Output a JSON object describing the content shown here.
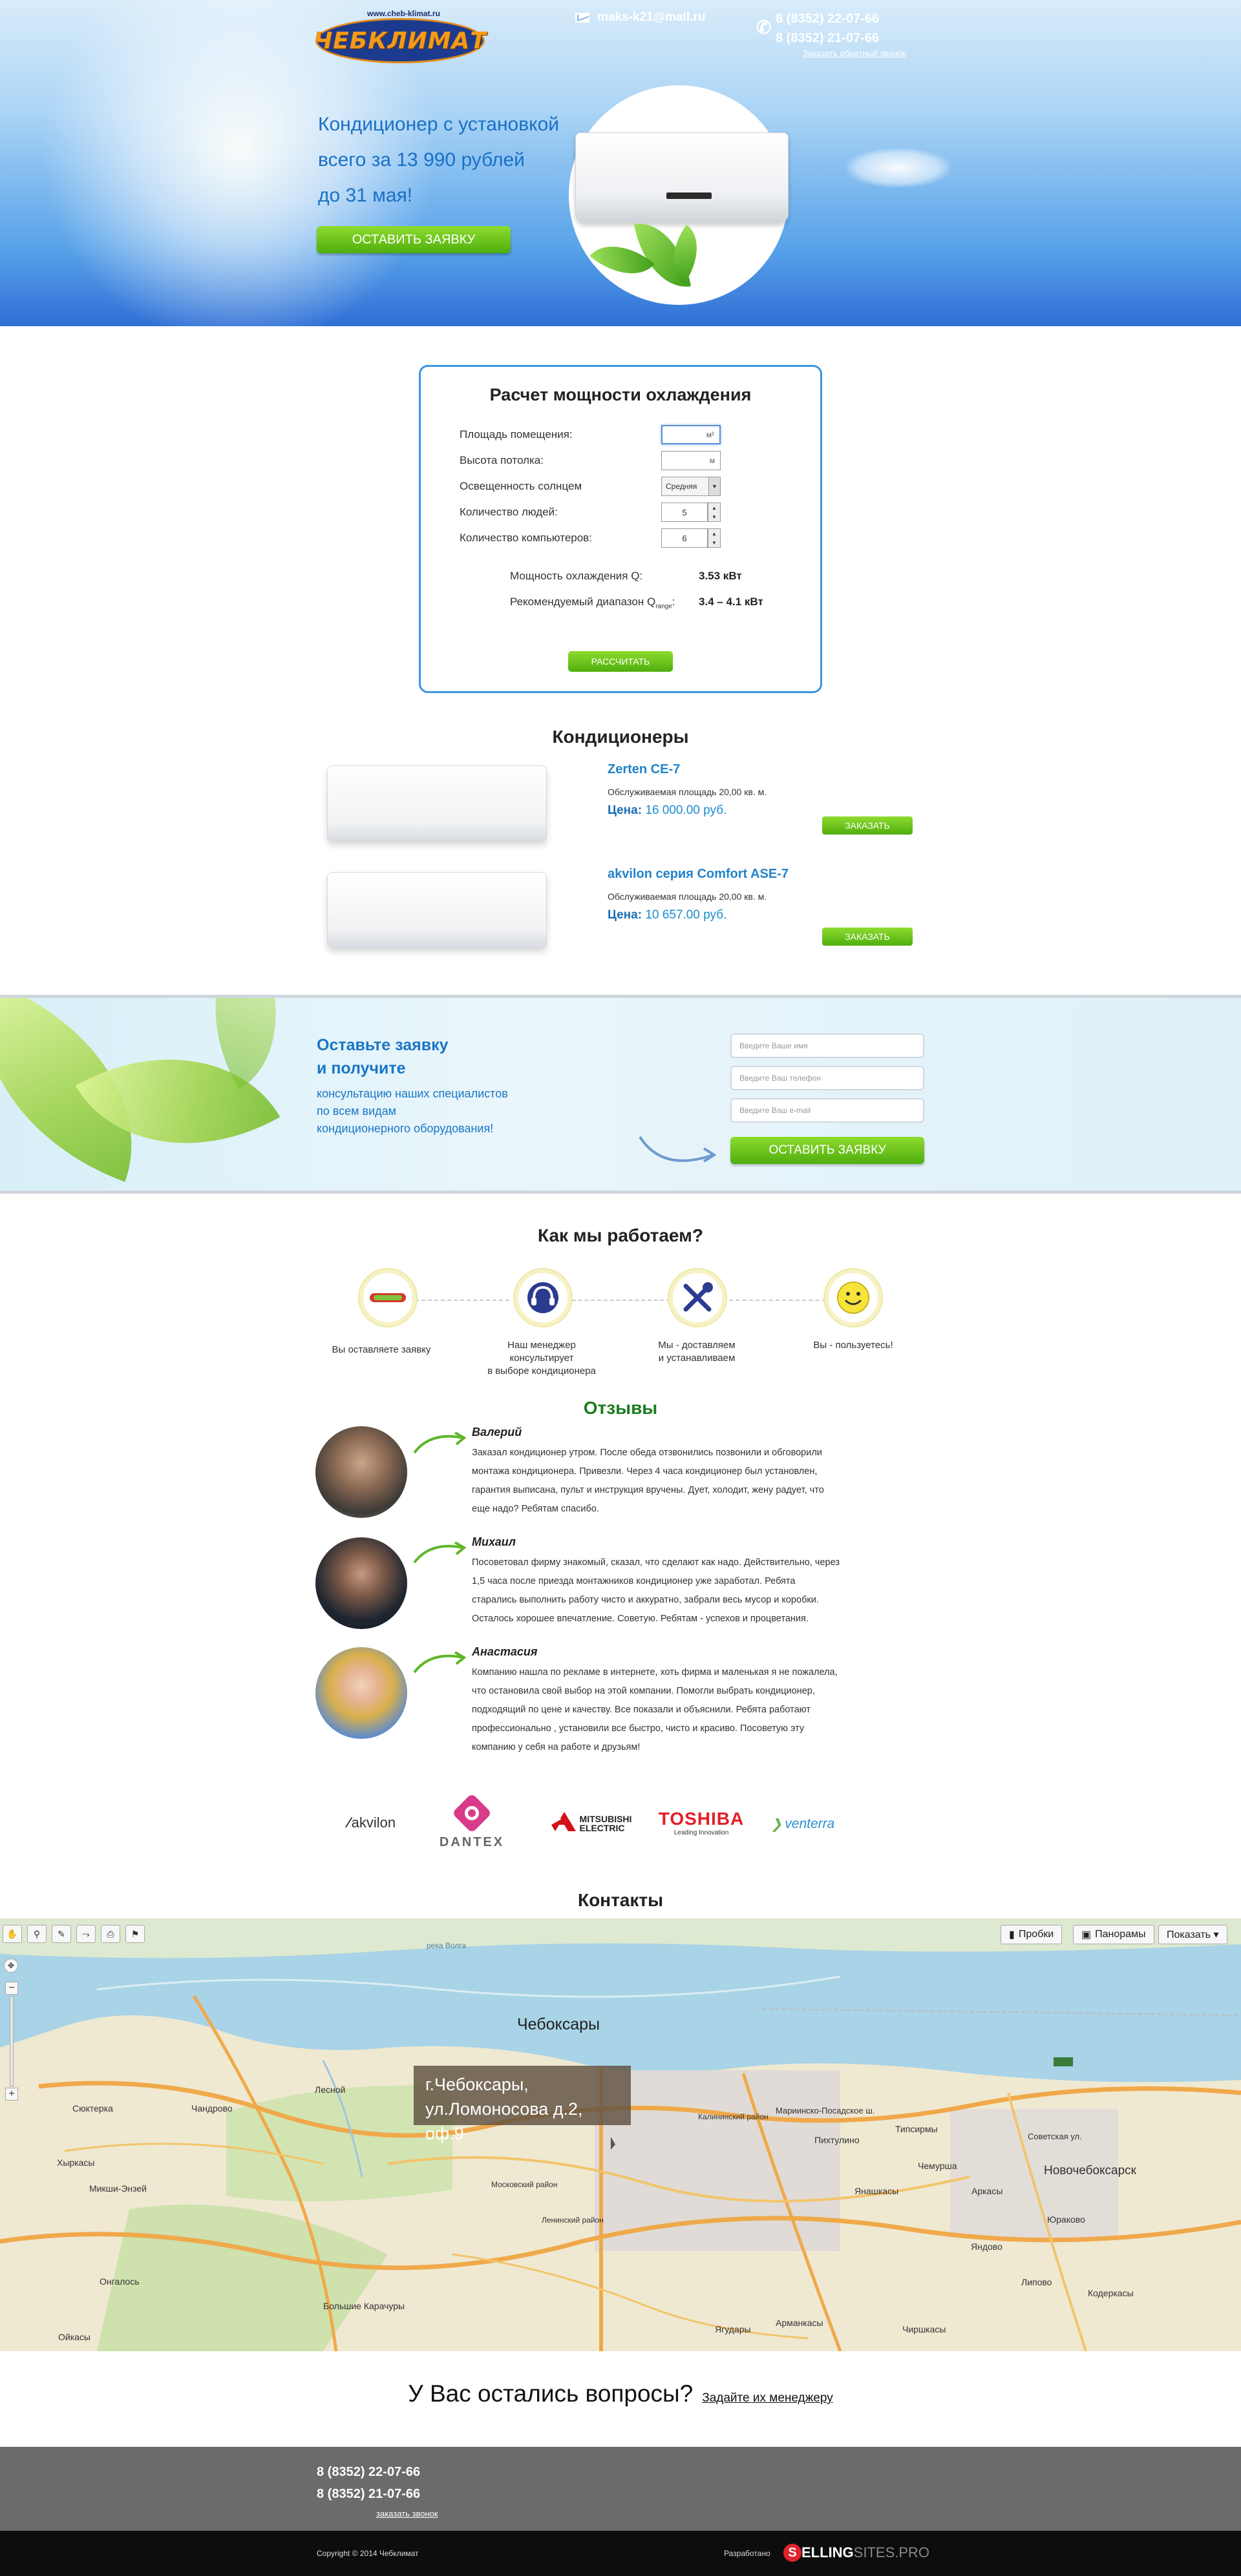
{
  "header": {
    "logo_site": "www.cheb-klimat.ru",
    "logo_text": "ЧЕБКЛИМАТ",
    "email": "maks-k21@mail.ru",
    "phone1": "8 (8352) 22-07-66",
    "phone2": "8 (8352) 21-07-66",
    "callback": "Заказать обратный звонок"
  },
  "hero": {
    "line1": "Кондиционер с установкой",
    "line2": "всего за 13 990 рублей",
    "line3": "до 31 мая!",
    "button": "ОСТАВИТЬ ЗАЯВКУ"
  },
  "calc": {
    "title": "Расчет мощности охлаждения",
    "area_label": "Площадь помещения:",
    "area_unit": "м²",
    "height_label": "Высота потолка:",
    "height_unit": "м",
    "sun_label": "Освещенность солнцем",
    "sun_value": "Средняя",
    "people_label": "Количество людей:",
    "people_value": "5",
    "pc_label": "Количество компьютеров:",
    "pc_value": "6",
    "power_label": "Мощность охлаждения Q:",
    "power_value": "3.53 кВт",
    "range_label": "Рекомендуемый диапазон Q",
    "range_sub": "range",
    "range_value": "3.4 – 4.1 кВт",
    "button": "РАССЧИТАТЬ"
  },
  "products": {
    "title": "Кондиционеры",
    "items": [
      {
        "name": "Zerten CE-7",
        "area": "Обслуживаемая площадь 20,00 кв. м.",
        "price_label": "Цена:",
        "price": "16 000.00 руб.",
        "button": "ЗАКАЗАТЬ"
      },
      {
        "name": "akvilon серия Comfort ASE-7",
        "area": "Обслуживаемая площадь 20,00 кв. м.",
        "price_label": "Цена:",
        "price": "10 657.00 руб.",
        "button": "ЗАКАЗАТЬ"
      }
    ]
  },
  "lead": {
    "title1": "Оставьте заявку",
    "title2": "и получите",
    "sub1": "консультацию наших специалистов",
    "sub2": "по всем видам",
    "sub3": "кондиционерного оборудования!",
    "name_placeholder": "Введите Ваше имя",
    "phone_placeholder": "Введите Ваш телефон",
    "email_placeholder": "Введите Ваш e-mail",
    "button": "ОСТАВИТЬ ЗАЯВКУ"
  },
  "how": {
    "title": "Как мы работаем?",
    "steps": [
      {
        "l1": "Вы оставляете заявку",
        "l2": "",
        "icon": "phone-icon"
      },
      {
        "l1": "Наш менеджер консультирует",
        "l2": "в выборе кондиционера",
        "icon": "headset-icon"
      },
      {
        "l1": "Мы - доставляем",
        "l2": "и устанавливаем",
        "icon": "tools-icon"
      },
      {
        "l1": "Вы - пользуетесь!",
        "l2": "",
        "icon": "smiley-icon"
      }
    ]
  },
  "reviews": {
    "title": "Отзывы",
    "items": [
      {
        "name": "Валерий",
        "lines": [
          "Заказал кондиционер утром. После обеда отзвонились позвонили и обговорили",
          "монтажа кондиционера. Привезли. Через 4 часа кондиционер был установлен,",
          "гарантия выписана, пульт и инструкция вручены. Дует, холодит, жену радует, что",
          "еще надо? Ребятам спасибо."
        ]
      },
      {
        "name": "Михаил",
        "lines": [
          "Посоветовал фирму знакомый, сказал, что сделают как надо. Действительно, через",
          "1,5 часа после приезда монтажников кондиционер уже заработал. Ребята",
          "старались выполнить работу чисто и аккуратно, забрали весь мусор и коробки.",
          "Осталось хорошее впечатление. Советую. Ребятам - успехов и процветания."
        ]
      },
      {
        "name": "Анастасия",
        "lines": [
          "Компанию нашла по рекламе в интернете, хоть фирма и маленькая я не пожалела,",
          "что остановила свой выбор на этой компании. Помогли выбрать кондиционер,",
          "подходящий по цене и качеству. Все показали и объяснили. Ребята работают",
          "профессионально , установили все быстро, чисто и красиво. Посоветую эту",
          "компанию у себя на работе и друзьям!"
        ]
      }
    ]
  },
  "brands": {
    "akvilon": "akvilon",
    "dantex": "DANTEX",
    "mitsubishi1": "MITSUBISHI",
    "mitsubishi2": "ELECTRIC",
    "toshiba": "TOSHIBA",
    "toshiba_sub": "Leading Innovation",
    "venterra": "venterra"
  },
  "contacts": {
    "title": "Контакты",
    "map_buttons": [
      "Пробки",
      "Панорамы",
      "Показать ▾"
    ],
    "bubble1": "г.Чебоксары,",
    "bubble2": "ул.Ломоносова д.2, оф.9",
    "cities": {
      "cheb": "Чебоксары",
      "novocheb": "Новочебоксарск",
      "skhikterga": "Сюктерка",
      "chandrovo": "Чандрово",
      "lesnoy": "Лесной",
      "khyrkasy": "Хыркасы",
      "mikshi": "Микши-Энзей",
      "ongalos": "Онгалось",
      "oykasy": "Ойкасы",
      "karachury": "Большие Карачуры",
      "yargaly": "Ягудары",
      "armankasy": "Арманкасы",
      "chirshkasy": "Чиршкасы",
      "yanashkasy": "Янашкасы",
      "arkasy": "Аркасы",
      "lipovo": "Липово",
      "kodergasy": "Кодеркасы",
      "yandovo": "Яндово",
      "yurakovo": "Юраково",
      "chemursha": "Чемурша",
      "tipsirmy": "Типсирмы",
      "pikhtulino": "Пихтулино",
      "mariposad": "Мариинско-Посадское ш.",
      "sovetskaya": "Советская ул.",
      "lenin": "Ленинский район",
      "kalinin": "Калининский район",
      "moskov": "Московский район",
      "volga": "река Волга"
    }
  },
  "questions": {
    "text": "У Вас остались вопросы?",
    "link": "Задайте их менеджеру"
  },
  "footer": {
    "phone1": "8 (8352) 22-07-66",
    "phone2": "8 (8352) 21-07-66",
    "callback": "заказать звонок",
    "copyright": "Copyright © 2014 Чебклимат",
    "dev_label": "Разработано",
    "dev_brand_s": "S",
    "dev_brand_mid": "ELLING",
    "dev_brand_end": "SITES.PRO"
  }
}
